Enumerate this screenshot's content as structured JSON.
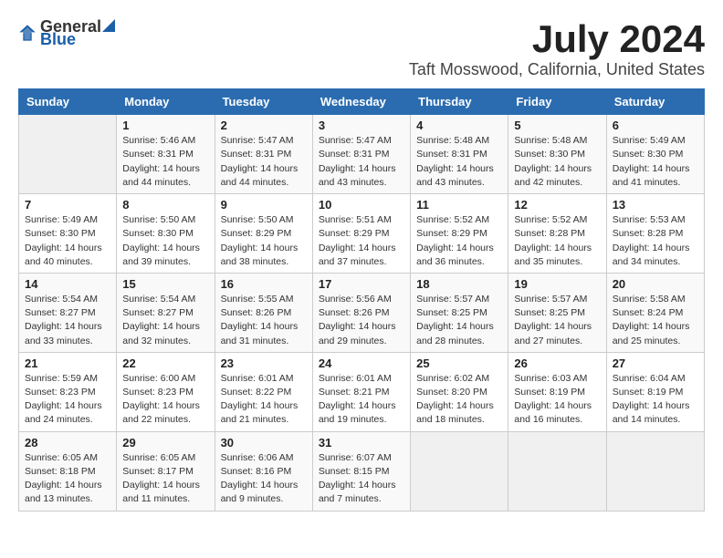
{
  "logo": {
    "text_general": "General",
    "text_blue": "Blue"
  },
  "title": "July 2024",
  "location": "Taft Mosswood, California, United States",
  "days_of_week": [
    "Sunday",
    "Monday",
    "Tuesday",
    "Wednesday",
    "Thursday",
    "Friday",
    "Saturday"
  ],
  "weeks": [
    [
      {
        "day": "",
        "info": ""
      },
      {
        "day": "1",
        "info": "Sunrise: 5:46 AM\nSunset: 8:31 PM\nDaylight: 14 hours\nand 44 minutes."
      },
      {
        "day": "2",
        "info": "Sunrise: 5:47 AM\nSunset: 8:31 PM\nDaylight: 14 hours\nand 44 minutes."
      },
      {
        "day": "3",
        "info": "Sunrise: 5:47 AM\nSunset: 8:31 PM\nDaylight: 14 hours\nand 43 minutes."
      },
      {
        "day": "4",
        "info": "Sunrise: 5:48 AM\nSunset: 8:31 PM\nDaylight: 14 hours\nand 43 minutes."
      },
      {
        "day": "5",
        "info": "Sunrise: 5:48 AM\nSunset: 8:30 PM\nDaylight: 14 hours\nand 42 minutes."
      },
      {
        "day": "6",
        "info": "Sunrise: 5:49 AM\nSunset: 8:30 PM\nDaylight: 14 hours\nand 41 minutes."
      }
    ],
    [
      {
        "day": "7",
        "info": "Sunrise: 5:49 AM\nSunset: 8:30 PM\nDaylight: 14 hours\nand 40 minutes."
      },
      {
        "day": "8",
        "info": "Sunrise: 5:50 AM\nSunset: 8:30 PM\nDaylight: 14 hours\nand 39 minutes."
      },
      {
        "day": "9",
        "info": "Sunrise: 5:50 AM\nSunset: 8:29 PM\nDaylight: 14 hours\nand 38 minutes."
      },
      {
        "day": "10",
        "info": "Sunrise: 5:51 AM\nSunset: 8:29 PM\nDaylight: 14 hours\nand 37 minutes."
      },
      {
        "day": "11",
        "info": "Sunrise: 5:52 AM\nSunset: 8:29 PM\nDaylight: 14 hours\nand 36 minutes."
      },
      {
        "day": "12",
        "info": "Sunrise: 5:52 AM\nSunset: 8:28 PM\nDaylight: 14 hours\nand 35 minutes."
      },
      {
        "day": "13",
        "info": "Sunrise: 5:53 AM\nSunset: 8:28 PM\nDaylight: 14 hours\nand 34 minutes."
      }
    ],
    [
      {
        "day": "14",
        "info": "Sunrise: 5:54 AM\nSunset: 8:27 PM\nDaylight: 14 hours\nand 33 minutes."
      },
      {
        "day": "15",
        "info": "Sunrise: 5:54 AM\nSunset: 8:27 PM\nDaylight: 14 hours\nand 32 minutes."
      },
      {
        "day": "16",
        "info": "Sunrise: 5:55 AM\nSunset: 8:26 PM\nDaylight: 14 hours\nand 31 minutes."
      },
      {
        "day": "17",
        "info": "Sunrise: 5:56 AM\nSunset: 8:26 PM\nDaylight: 14 hours\nand 29 minutes."
      },
      {
        "day": "18",
        "info": "Sunrise: 5:57 AM\nSunset: 8:25 PM\nDaylight: 14 hours\nand 28 minutes."
      },
      {
        "day": "19",
        "info": "Sunrise: 5:57 AM\nSunset: 8:25 PM\nDaylight: 14 hours\nand 27 minutes."
      },
      {
        "day": "20",
        "info": "Sunrise: 5:58 AM\nSunset: 8:24 PM\nDaylight: 14 hours\nand 25 minutes."
      }
    ],
    [
      {
        "day": "21",
        "info": "Sunrise: 5:59 AM\nSunset: 8:23 PM\nDaylight: 14 hours\nand 24 minutes."
      },
      {
        "day": "22",
        "info": "Sunrise: 6:00 AM\nSunset: 8:23 PM\nDaylight: 14 hours\nand 22 minutes."
      },
      {
        "day": "23",
        "info": "Sunrise: 6:01 AM\nSunset: 8:22 PM\nDaylight: 14 hours\nand 21 minutes."
      },
      {
        "day": "24",
        "info": "Sunrise: 6:01 AM\nSunset: 8:21 PM\nDaylight: 14 hours\nand 19 minutes."
      },
      {
        "day": "25",
        "info": "Sunrise: 6:02 AM\nSunset: 8:20 PM\nDaylight: 14 hours\nand 18 minutes."
      },
      {
        "day": "26",
        "info": "Sunrise: 6:03 AM\nSunset: 8:19 PM\nDaylight: 14 hours\nand 16 minutes."
      },
      {
        "day": "27",
        "info": "Sunrise: 6:04 AM\nSunset: 8:19 PM\nDaylight: 14 hours\nand 14 minutes."
      }
    ],
    [
      {
        "day": "28",
        "info": "Sunrise: 6:05 AM\nSunset: 8:18 PM\nDaylight: 14 hours\nand 13 minutes."
      },
      {
        "day": "29",
        "info": "Sunrise: 6:05 AM\nSunset: 8:17 PM\nDaylight: 14 hours\nand 11 minutes."
      },
      {
        "day": "30",
        "info": "Sunrise: 6:06 AM\nSunset: 8:16 PM\nDaylight: 14 hours\nand 9 minutes."
      },
      {
        "day": "31",
        "info": "Sunrise: 6:07 AM\nSunset: 8:15 PM\nDaylight: 14 hours\nand 7 minutes."
      },
      {
        "day": "",
        "info": ""
      },
      {
        "day": "",
        "info": ""
      },
      {
        "day": "",
        "info": ""
      }
    ]
  ]
}
